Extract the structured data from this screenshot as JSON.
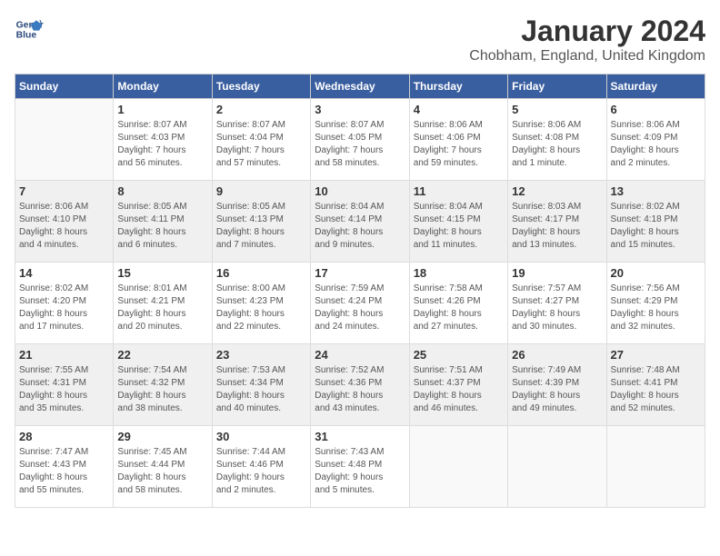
{
  "header": {
    "logo_line1": "General",
    "logo_line2": "Blue",
    "title": "January 2024",
    "subtitle": "Chobham, England, United Kingdom"
  },
  "weekdays": [
    "Sunday",
    "Monday",
    "Tuesday",
    "Wednesday",
    "Thursday",
    "Friday",
    "Saturday"
  ],
  "weeks": [
    [
      {
        "day": "",
        "info": ""
      },
      {
        "day": "1",
        "info": "Sunrise: 8:07 AM\nSunset: 4:03 PM\nDaylight: 7 hours\nand 56 minutes."
      },
      {
        "day": "2",
        "info": "Sunrise: 8:07 AM\nSunset: 4:04 PM\nDaylight: 7 hours\nand 57 minutes."
      },
      {
        "day": "3",
        "info": "Sunrise: 8:07 AM\nSunset: 4:05 PM\nDaylight: 7 hours\nand 58 minutes."
      },
      {
        "day": "4",
        "info": "Sunrise: 8:06 AM\nSunset: 4:06 PM\nDaylight: 7 hours\nand 59 minutes."
      },
      {
        "day": "5",
        "info": "Sunrise: 8:06 AM\nSunset: 4:08 PM\nDaylight: 8 hours\nand 1 minute."
      },
      {
        "day": "6",
        "info": "Sunrise: 8:06 AM\nSunset: 4:09 PM\nDaylight: 8 hours\nand 2 minutes."
      }
    ],
    [
      {
        "day": "7",
        "info": "Sunrise: 8:06 AM\nSunset: 4:10 PM\nDaylight: 8 hours\nand 4 minutes."
      },
      {
        "day": "8",
        "info": "Sunrise: 8:05 AM\nSunset: 4:11 PM\nDaylight: 8 hours\nand 6 minutes."
      },
      {
        "day": "9",
        "info": "Sunrise: 8:05 AM\nSunset: 4:13 PM\nDaylight: 8 hours\nand 7 minutes."
      },
      {
        "day": "10",
        "info": "Sunrise: 8:04 AM\nSunset: 4:14 PM\nDaylight: 8 hours\nand 9 minutes."
      },
      {
        "day": "11",
        "info": "Sunrise: 8:04 AM\nSunset: 4:15 PM\nDaylight: 8 hours\nand 11 minutes."
      },
      {
        "day": "12",
        "info": "Sunrise: 8:03 AM\nSunset: 4:17 PM\nDaylight: 8 hours\nand 13 minutes."
      },
      {
        "day": "13",
        "info": "Sunrise: 8:02 AM\nSunset: 4:18 PM\nDaylight: 8 hours\nand 15 minutes."
      }
    ],
    [
      {
        "day": "14",
        "info": "Sunrise: 8:02 AM\nSunset: 4:20 PM\nDaylight: 8 hours\nand 17 minutes."
      },
      {
        "day": "15",
        "info": "Sunrise: 8:01 AM\nSunset: 4:21 PM\nDaylight: 8 hours\nand 20 minutes."
      },
      {
        "day": "16",
        "info": "Sunrise: 8:00 AM\nSunset: 4:23 PM\nDaylight: 8 hours\nand 22 minutes."
      },
      {
        "day": "17",
        "info": "Sunrise: 7:59 AM\nSunset: 4:24 PM\nDaylight: 8 hours\nand 24 minutes."
      },
      {
        "day": "18",
        "info": "Sunrise: 7:58 AM\nSunset: 4:26 PM\nDaylight: 8 hours\nand 27 minutes."
      },
      {
        "day": "19",
        "info": "Sunrise: 7:57 AM\nSunset: 4:27 PM\nDaylight: 8 hours\nand 30 minutes."
      },
      {
        "day": "20",
        "info": "Sunrise: 7:56 AM\nSunset: 4:29 PM\nDaylight: 8 hours\nand 32 minutes."
      }
    ],
    [
      {
        "day": "21",
        "info": "Sunrise: 7:55 AM\nSunset: 4:31 PM\nDaylight: 8 hours\nand 35 minutes."
      },
      {
        "day": "22",
        "info": "Sunrise: 7:54 AM\nSunset: 4:32 PM\nDaylight: 8 hours\nand 38 minutes."
      },
      {
        "day": "23",
        "info": "Sunrise: 7:53 AM\nSunset: 4:34 PM\nDaylight: 8 hours\nand 40 minutes."
      },
      {
        "day": "24",
        "info": "Sunrise: 7:52 AM\nSunset: 4:36 PM\nDaylight: 8 hours\nand 43 minutes."
      },
      {
        "day": "25",
        "info": "Sunrise: 7:51 AM\nSunset: 4:37 PM\nDaylight: 8 hours\nand 46 minutes."
      },
      {
        "day": "26",
        "info": "Sunrise: 7:49 AM\nSunset: 4:39 PM\nDaylight: 8 hours\nand 49 minutes."
      },
      {
        "day": "27",
        "info": "Sunrise: 7:48 AM\nSunset: 4:41 PM\nDaylight: 8 hours\nand 52 minutes."
      }
    ],
    [
      {
        "day": "28",
        "info": "Sunrise: 7:47 AM\nSunset: 4:43 PM\nDaylight: 8 hours\nand 55 minutes."
      },
      {
        "day": "29",
        "info": "Sunrise: 7:45 AM\nSunset: 4:44 PM\nDaylight: 8 hours\nand 58 minutes."
      },
      {
        "day": "30",
        "info": "Sunrise: 7:44 AM\nSunset: 4:46 PM\nDaylight: 9 hours\nand 2 minutes."
      },
      {
        "day": "31",
        "info": "Sunrise: 7:43 AM\nSunset: 4:48 PM\nDaylight: 9 hours\nand 5 minutes."
      },
      {
        "day": "",
        "info": ""
      },
      {
        "day": "",
        "info": ""
      },
      {
        "day": "",
        "info": ""
      }
    ]
  ]
}
